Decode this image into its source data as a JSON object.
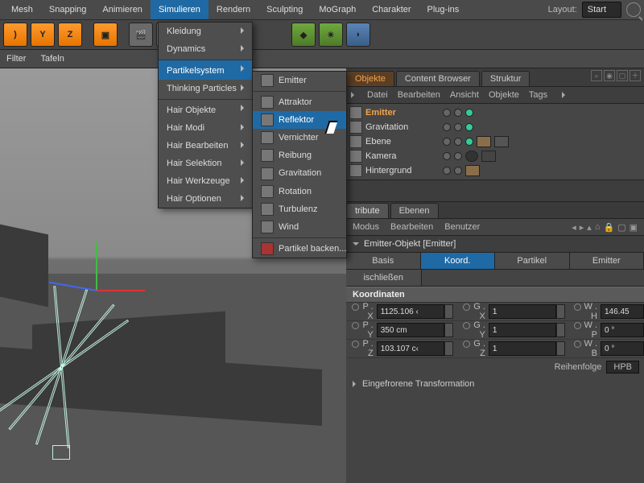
{
  "topmenu": {
    "items": [
      "Mesh",
      "Snapping",
      "Animieren",
      "Simulieren",
      "Rendern",
      "Sculpting",
      "MoGraph",
      "Charakter",
      "Plug-ins"
    ],
    "open_index": 3,
    "layout_label": "Layout:",
    "layout_value": "Start"
  },
  "subbar": {
    "filter": "Filter",
    "tafeln": "Tafeln"
  },
  "sim_menu": {
    "items": [
      {
        "label": "Kleidung",
        "sub": true
      },
      {
        "label": "Dynamics",
        "sub": true,
        "sep_after": true
      },
      {
        "label": "Partikelsystem",
        "sub": true,
        "hl": true
      },
      {
        "label": "Thinking Particles",
        "sub": true,
        "sep_after": true
      },
      {
        "label": "Hair Objekte",
        "sub": true
      },
      {
        "label": "Hair Modi",
        "sub": true
      },
      {
        "label": "Hair Bearbeiten",
        "sub": true
      },
      {
        "label": "Hair Selektion",
        "sub": true
      },
      {
        "label": "Hair Werkzeuge",
        "sub": true
      },
      {
        "label": "Hair Optionen",
        "sub": true
      }
    ]
  },
  "particle_menu": {
    "items": [
      {
        "label": "Emitter",
        "sep_after": true
      },
      {
        "label": "Attraktor"
      },
      {
        "label": "Reflektor",
        "hl": true
      },
      {
        "label": "Vernichter"
      },
      {
        "label": "Reibung"
      },
      {
        "label": "Gravitation"
      },
      {
        "label": "Rotation"
      },
      {
        "label": "Turbulenz"
      },
      {
        "label": "Wind",
        "sep_after": true
      },
      {
        "label": "Partikel backen..."
      }
    ]
  },
  "right": {
    "tabs": [
      "Objekte",
      "Content Browser",
      "Struktur"
    ],
    "active_tab": 0,
    "panel_menu": [
      "Datei",
      "Bearbeiten",
      "Ansicht",
      "Objekte",
      "Tags"
    ],
    "objects": [
      {
        "name": "Emitter",
        "selected": true
      },
      {
        "name": "Gravitation"
      },
      {
        "name": "Ebene"
      },
      {
        "name": "Kamera"
      },
      {
        "name": "Hintergrund"
      }
    ],
    "attr_tabs": [
      "tribute",
      "Ebenen"
    ],
    "attr_bar": [
      "Modus",
      "Bearbeiten",
      "Benutzer"
    ],
    "attr_title": "Emitter-Objekt [Emitter]",
    "btabs": [
      "Basis",
      "Koord.",
      "Partikel",
      "Emitter"
    ],
    "btab_active": 1,
    "btab_row2": "ischließen",
    "section": "Koordinaten",
    "coords": [
      {
        "p": "P . X",
        "pv": "1125.106 ‹",
        "g": "G . X",
        "gv": "1",
        "w": "W . H",
        "wv": "146.45"
      },
      {
        "p": "P . Y",
        "pv": "350 cm",
        "g": "G . Y",
        "gv": "1",
        "w": "W . P",
        "wv": "0 °"
      },
      {
        "p": "P . Z",
        "pv": "103.107 c‹",
        "g": "G . Z",
        "gv": "1",
        "w": "W . B",
        "wv": "0 °"
      }
    ],
    "reihenfolge_lbl": "Reihenfolge",
    "reihenfolge_val": "HPB",
    "frozen": "Eingefrorene Transformation"
  }
}
